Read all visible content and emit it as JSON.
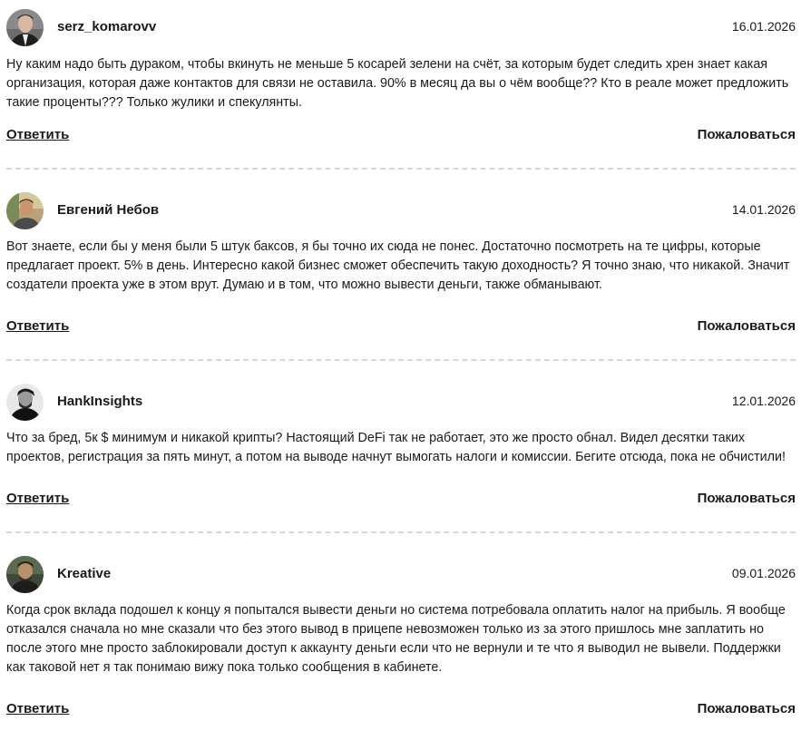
{
  "comments": [
    {
      "author": "serz_komarovv",
      "date": "16.01.2026",
      "text": "Ну каким надо быть дураком, чтобы вкинуть не меньше 5 косарей зелени на счёт, за которым будет следить хрен знает какая организация, которая даже контактов для связи не оставила. 90% в месяц да вы о чём вообще?? Кто в реале может предложить такие проценты??? Только жулики и спекулянты.",
      "reply_label": "Ответить",
      "report_label": "Пожаловаться"
    },
    {
      "author": "Евгений Небов",
      "date": "14.01.2026",
      "text": "Вот знаете, если бы у меня были 5 штук баксов, я бы точно их сюда не понес. Достаточно посмотреть на те цифры, которые предлагает проект. 5% в день. Интересно какой бизнес сможет обеспечить такую доходность? Я точно знаю, что никакой. Значит создатели проекта уже в этом врут. Думаю и в том, что можно вывести деньги, также обманывают.",
      "reply_label": "Ответить",
      "report_label": "Пожаловаться"
    },
    {
      "author": "HankInsights",
      "date": "12.01.2026",
      "text": "Что за бред, 5к $ минимум и никакой крипты? Настоящий DeFi так не работает, это же просто обнал. Видел десятки таких проектов, регистрация за пять минут, а потом на выводе начнут вымогать налоги и комиссии. Бегите отсюда, пока не обчистили!",
      "reply_label": "Ответить",
      "report_label": "Пожаловаться"
    },
    {
      "author": "Kreative",
      "date": "09.01.2026",
      "text": "Когда срок вклада подошел к концу я попытался вывести деньги но система потребовала оплатить налог на прибыль. Я вообще отказался сначала но мне сказали что без этого вывод в прицепе невозможен только из за этого пришлось мне заплатить но после этого мне просто заблокировали доступ к аккаунту деньги если что не вернули и те что я выводил не вывели. Поддержки как таковой нет я так понимаю вижу пока только сообщения в кабинете.",
      "reply_label": "Ответить",
      "report_label": "Пожаловаться"
    }
  ]
}
